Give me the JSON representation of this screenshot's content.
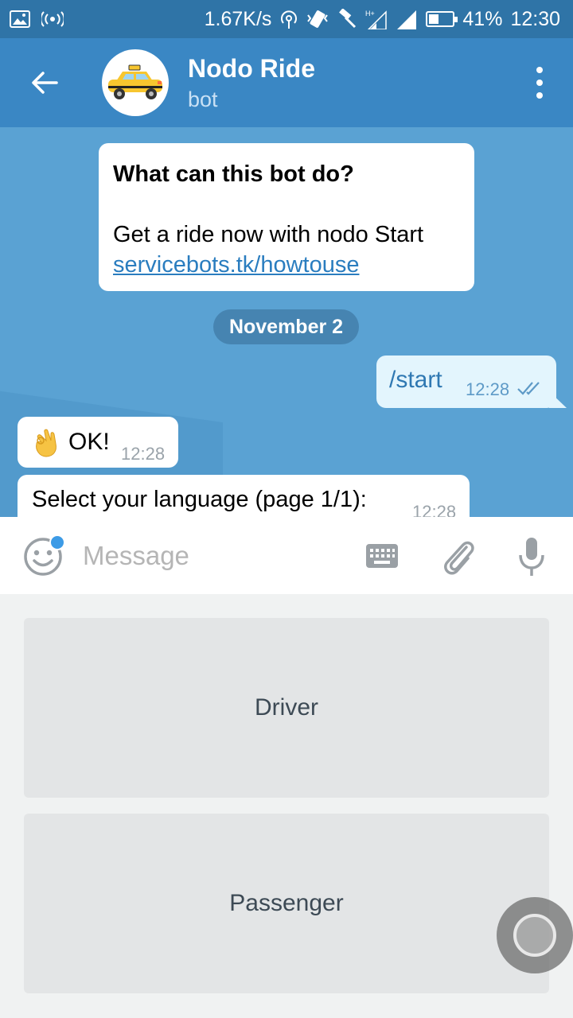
{
  "status_bar": {
    "speed": "1.67K/s",
    "battery": "41%",
    "battery_level": 0.41,
    "time": "12:30",
    "icons": [
      "image-icon",
      "hotspot-icon",
      "nfc-icon",
      "vibrate-icon",
      "hammer-icon",
      "signal-h-plus-icon",
      "signal-icon",
      "battery-icon"
    ]
  },
  "header": {
    "title": "Nodo Ride",
    "subtitle": "bot",
    "avatar_icon": "taxi-icon"
  },
  "chat": {
    "info_card": {
      "question": "What can this bot do?",
      "description": "Get a ride now with nodo Start",
      "link": "servicebots.tk/howtouse"
    },
    "date_separator": "November 2",
    "messages": [
      {
        "direction": "outgoing",
        "text": "/start",
        "time": "12:28",
        "status": "read"
      },
      {
        "direction": "incoming",
        "emoji": "ok-hand-icon",
        "text": "OK!",
        "time": "12:28"
      },
      {
        "direction": "incoming",
        "text": "Select your language (page 1/1):",
        "time": "12:28"
      }
    ]
  },
  "input_bar": {
    "placeholder": "Message"
  },
  "keyboard": {
    "buttons": [
      "Driver",
      "Passenger"
    ]
  },
  "colors": {
    "header": "#3a87c4",
    "status_bar": "#2f74a7",
    "chat_bg": "#5aa2d3",
    "link": "#2a7dbf"
  }
}
